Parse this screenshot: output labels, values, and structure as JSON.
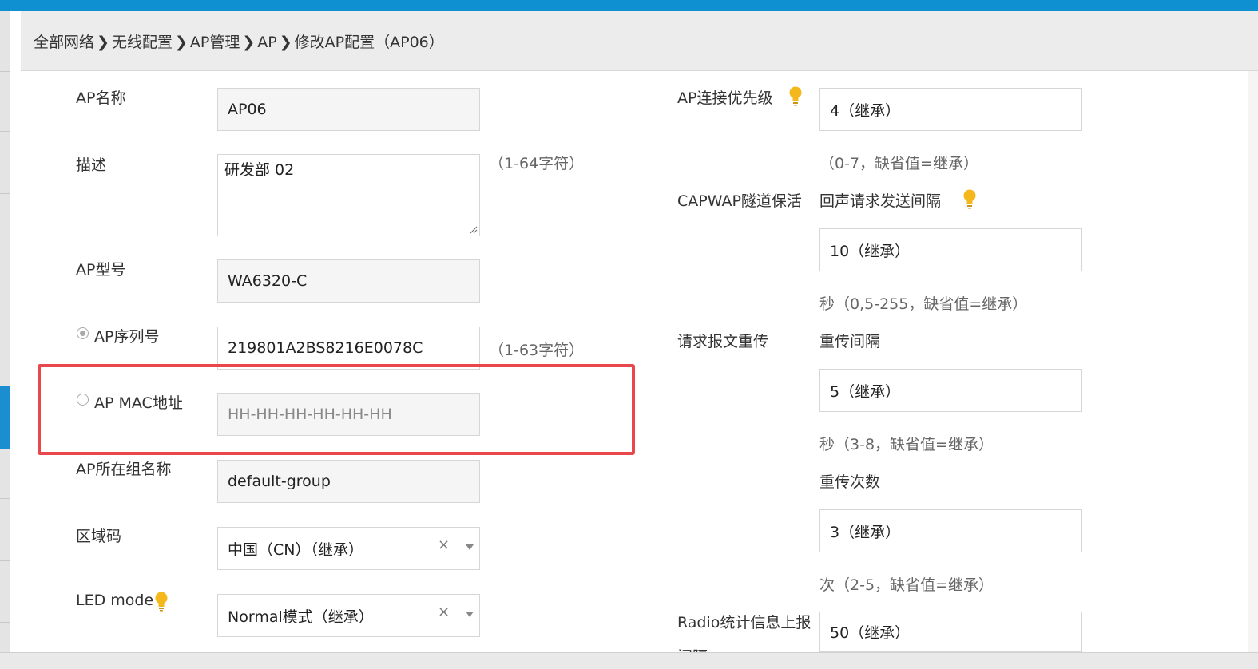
{
  "breadcrumb": [
    "全部网络",
    "无线配置",
    "AP管理",
    "AP",
    "修改AP配置（AP06）"
  ],
  "left": {
    "ap_name": {
      "label": "AP名称",
      "value": "AP06"
    },
    "description": {
      "label": "描述",
      "value": "研发部 02",
      "hint": "（1-64字符）"
    },
    "ap_model": {
      "label": "AP型号",
      "value": "WA6320-C"
    },
    "ap_serial": {
      "label": "AP序列号",
      "value": "219801A2BS8216E0078C",
      "hint": "（1-63字符）"
    },
    "ap_mac": {
      "label": "AP MAC地址",
      "placeholder": "HH-HH-HH-HH-HH-HH"
    },
    "ap_group": {
      "label": "AP所在组名称",
      "value": "default-group"
    },
    "region_code": {
      "label": "区域码",
      "value": "中国（CN）（继承）",
      "clear": "×"
    },
    "led_mode": {
      "label": "LED mode",
      "value": "Normal模式（继承）",
      "clear": "×"
    }
  },
  "right": {
    "priority": {
      "label": "AP连接优先级",
      "value": "4（继承）",
      "hint": "（0-7，缺省值=继承）"
    },
    "capwap": {
      "label": "CAPWAP隧道保活",
      "sublabel": "回声请求发送间隔",
      "value": "10（继承）",
      "hint": "秒（0,5-255，缺省值=继承）"
    },
    "retransmit": {
      "label": "请求报文重传",
      "interval_label": "重传间隔",
      "interval_value": "5（继承）",
      "interval_hint": "秒（3-8，缺省值=继承）",
      "count_label": "重传次数",
      "count_value": "3（继承）",
      "count_hint": "次（2-5，缺省值=继承）"
    },
    "radio_stats": {
      "label": "Radio统计信息上报",
      "label_cont": "间隔",
      "value": "50（继承）"
    }
  },
  "icons": {
    "bulb": "lightbulb-icon",
    "chevron": "breadcrumb-chevron-icon"
  },
  "colors": {
    "accent": "#0f90d0",
    "highlight": "#e8474c",
    "bulb": "#f5b81c"
  }
}
